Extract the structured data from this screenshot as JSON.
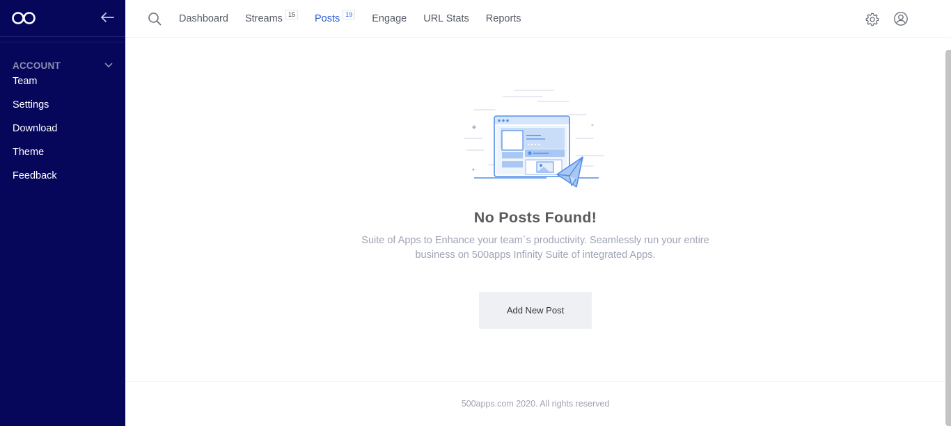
{
  "sidebar": {
    "logo_icon": "infinity-logo",
    "collapse_icon": "arrow-left-icon",
    "section_label": "ACCOUNT",
    "section_icon": "chevron-down-icon",
    "items": [
      {
        "label": "Team"
      },
      {
        "label": "Settings"
      },
      {
        "label": "Download"
      },
      {
        "label": "Theme"
      },
      {
        "label": "Feedback"
      }
    ],
    "background": "#06065a"
  },
  "header": {
    "search_icon": "search-icon",
    "nav": [
      {
        "label": "Dashboard",
        "badge": ""
      },
      {
        "label": "Streams",
        "badge": "15"
      },
      {
        "label": "Posts",
        "badge": "19",
        "active": true
      },
      {
        "label": "Engage",
        "badge": ""
      },
      {
        "label": "URL Stats",
        "badge": ""
      },
      {
        "label": "Reports",
        "badge": ""
      }
    ],
    "settings_icon": "gear-icon",
    "profile_icon": "user-circle-icon",
    "accent": "#2e5bd6"
  },
  "empty_state": {
    "illustration": "browser-paper-plane-illustration",
    "title": "No Posts Found!",
    "description": "Suite of Apps to Enhance your team`s productivity. Seamlessly run your entire business on 500apps Infinity Suite of integrated Apps.",
    "button_label": "Add New Post"
  },
  "footer": {
    "text": "500apps.com 2020. All rights reserved"
  }
}
